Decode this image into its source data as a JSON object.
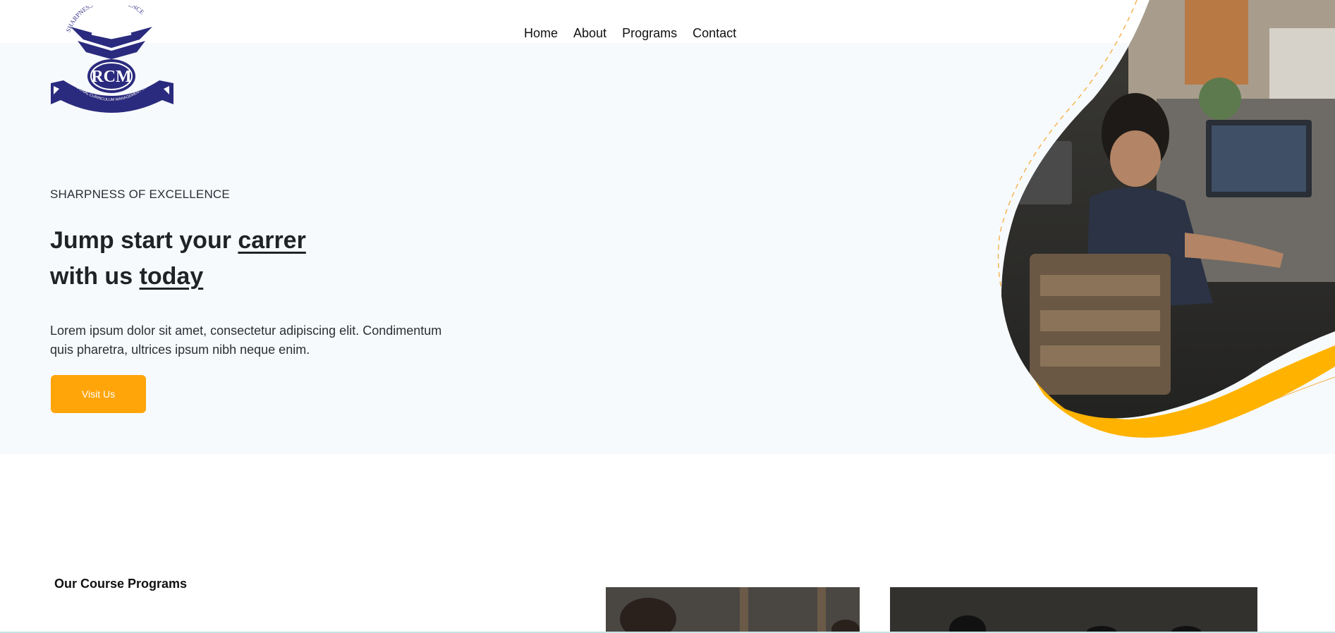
{
  "brand": {
    "logo_text": "RCM",
    "logo_arc_text": "SHARPNESS OF EXCELLENCE",
    "logo_ribbon_text": "REGIONAL CURRICULUM MANAGEMENT COLLEGE"
  },
  "nav": {
    "items": [
      {
        "label": "Home"
      },
      {
        "label": "About"
      },
      {
        "label": "Programs"
      },
      {
        "label": "Contact"
      }
    ]
  },
  "hero": {
    "tagline": "SHARPNESS OF EXCELLENCE",
    "headline_part1": "Jump start your ",
    "headline_underlined1": "carrer",
    "headline_part2": "with us ",
    "headline_underlined2": "today",
    "lead": "Lorem ipsum dolor sit amet, consectetur adipiscing elit. Condimentum quis pharetra, ultrices ipsum nibh neque enim.",
    "cta_label": "Visit Us"
  },
  "programs": {
    "title": "Our Course Programs"
  },
  "colors": {
    "accent": "#ffa50a",
    "wave": "#ffb300",
    "logo_navy": "#2a2a7e",
    "hero_bg": "#f7fafc"
  }
}
